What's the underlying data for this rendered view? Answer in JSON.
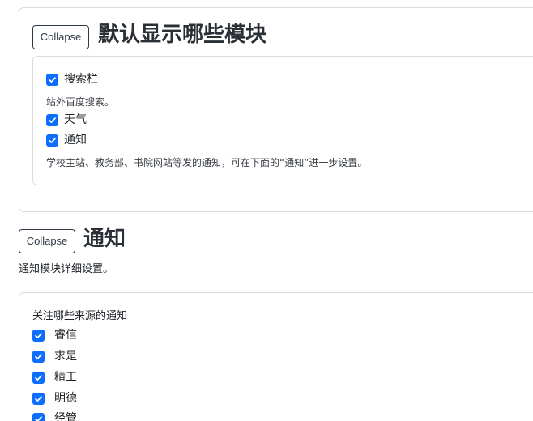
{
  "modules_section": {
    "collapse_label": "Collapse",
    "title": "默认显示哪些模块",
    "items": [
      {
        "label": "搜索栏",
        "checked": true
      },
      {
        "label": "天气",
        "checked": true
      },
      {
        "label": "通知",
        "checked": true
      }
    ],
    "search_note": "站外百度搜索。",
    "notice_note": "学校主站、教务部、书院网站等发的通知，可在下面的“通知”进一步设置。"
  },
  "notice_section": {
    "collapse_label": "Collapse",
    "title": "通知",
    "description": "通知模块详细设置。",
    "sources_label": "关注哪些来源的通知",
    "sources": [
      {
        "label": "睿信",
        "checked": true
      },
      {
        "label": "求是",
        "checked": true
      },
      {
        "label": "精工",
        "checked": true
      },
      {
        "label": "明德",
        "checked": true
      },
      {
        "label": "经管",
        "checked": true
      }
    ]
  },
  "colors": {
    "checkbox_accent": "#0d6efd",
    "button_border": "#2f3a48",
    "card_border": "#dcdcdc"
  }
}
